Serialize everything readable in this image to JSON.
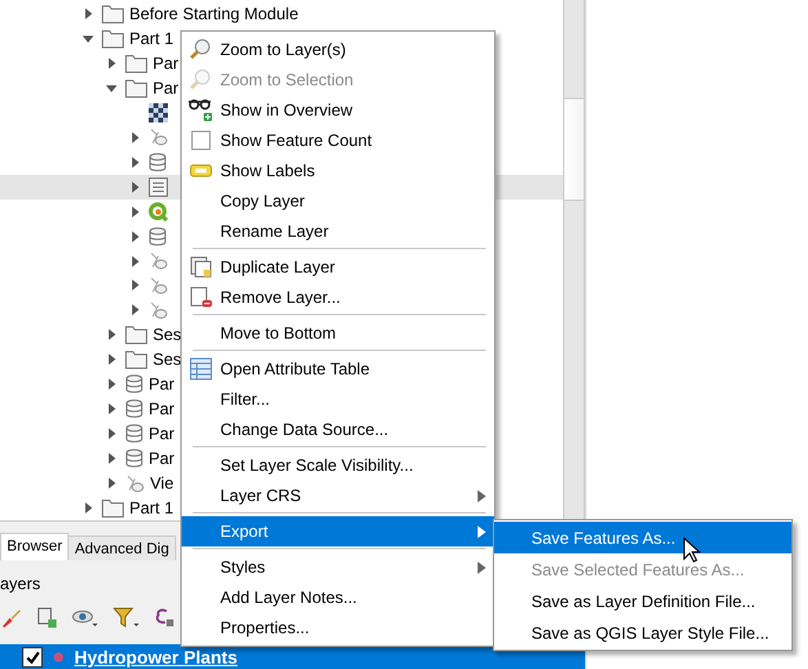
{
  "tree": [
    {
      "kind": "folder",
      "label": "Before Starting Module",
      "expanded": false,
      "selected": false
    },
    {
      "kind": "folder",
      "label": "Part 1",
      "expanded": true,
      "selected": false,
      "children": [
        {
          "kind": "folder",
          "label": "Par",
          "expanded": false,
          "selected": false
        },
        {
          "kind": "folder",
          "label": "Par",
          "expanded": true,
          "selected": false,
          "children": [
            {
              "kind": "raster",
              "selected": false
            },
            {
              "kind": "vector",
              "expanded": false,
              "selected": false
            },
            {
              "kind": "database",
              "expanded": false,
              "selected": false
            },
            {
              "kind": "table",
              "expanded": false,
              "selected": true
            },
            {
              "kind": "qgis",
              "expanded": false,
              "selected": false
            },
            {
              "kind": "database",
              "expanded": false,
              "selected": false
            },
            {
              "kind": "vector",
              "expanded": false,
              "selected": false
            },
            {
              "kind": "vector",
              "expanded": false,
              "selected": false
            },
            {
              "kind": "vector",
              "expanded": false,
              "selected": false
            }
          ]
        },
        {
          "kind": "folder",
          "label": "Ses",
          "expanded": false,
          "selected": false
        },
        {
          "kind": "folder",
          "label": "Ses",
          "expanded": false,
          "selected": false
        },
        {
          "kind": "database",
          "label": "Par",
          "expanded": false,
          "selected": false
        },
        {
          "kind": "database",
          "label": "Par",
          "expanded": false,
          "selected": false
        },
        {
          "kind": "database",
          "label": "Par",
          "expanded": false,
          "selected": false
        },
        {
          "kind": "database",
          "label": "Par",
          "expanded": false,
          "selected": false
        },
        {
          "kind": "vector",
          "label": "Vie",
          "expanded": false,
          "selected": false
        }
      ]
    },
    {
      "kind": "folder",
      "label": "Part 1",
      "expanded": false,
      "selected": false
    }
  ],
  "dock_tabs": [
    {
      "label": "Browser",
      "selected": true
    },
    {
      "label": "Advanced Dig",
      "selected": false
    }
  ],
  "layers_panel": {
    "title": "ayers",
    "layers": [
      {
        "label": "Hydropower Plants",
        "checked": true,
        "color": "#c8507a",
        "selected": true
      }
    ]
  },
  "context_menu": [
    {
      "kind": "item",
      "label": "Zoom to Layer(s)",
      "disabled": false,
      "selected": false
    },
    {
      "kind": "item",
      "label": "Zoom to Selection",
      "disabled": true,
      "selected": false
    },
    {
      "kind": "item",
      "label": "Show in Overview",
      "disabled": false,
      "selected": false
    },
    {
      "kind": "check",
      "label": "Show Feature Count",
      "checked": false,
      "disabled": false,
      "selected": false
    },
    {
      "kind": "item",
      "label": "Show Labels",
      "disabled": false,
      "selected": false
    },
    {
      "kind": "item",
      "label": "Copy Layer",
      "disabled": false,
      "selected": false
    },
    {
      "kind": "item",
      "label": "Rename Layer",
      "disabled": false,
      "selected": false
    },
    {
      "kind": "separator"
    },
    {
      "kind": "item",
      "label": "Duplicate Layer",
      "disabled": false,
      "selected": false
    },
    {
      "kind": "item",
      "label": "Remove Layer...",
      "disabled": false,
      "selected": false
    },
    {
      "kind": "separator"
    },
    {
      "kind": "item",
      "label": "Move to Bottom",
      "disabled": false,
      "selected": false
    },
    {
      "kind": "separator"
    },
    {
      "kind": "item",
      "label": "Open Attribute Table",
      "disabled": false,
      "selected": false
    },
    {
      "kind": "item",
      "label": "Filter...",
      "disabled": false,
      "selected": false
    },
    {
      "kind": "item",
      "label": "Change Data Source...",
      "disabled": false,
      "selected": false
    },
    {
      "kind": "separator"
    },
    {
      "kind": "item",
      "label": "Set Layer Scale Visibility...",
      "disabled": false,
      "selected": false
    },
    {
      "kind": "submenu",
      "label": "Layer CRS",
      "disabled": false,
      "selected": false
    },
    {
      "kind": "separator"
    },
    {
      "kind": "submenu",
      "label": "Export",
      "disabled": false,
      "selected": true
    },
    {
      "kind": "separator"
    },
    {
      "kind": "submenu",
      "label": "Styles",
      "disabled": false,
      "selected": false
    },
    {
      "kind": "item",
      "label": "Add Layer Notes...",
      "disabled": false,
      "selected": false
    },
    {
      "kind": "item",
      "label": "Properties...",
      "disabled": false,
      "selected": false
    }
  ],
  "export_submenu": [
    {
      "label": "Save Features As...",
      "disabled": false,
      "selected": true
    },
    {
      "label": "Save Selected Features As...",
      "disabled": true,
      "selected": false
    },
    {
      "label": "Save as Layer Definition File...",
      "disabled": false,
      "selected": false
    },
    {
      "label": "Save as QGIS Layer Style File...",
      "disabled": false,
      "selected": false
    }
  ]
}
